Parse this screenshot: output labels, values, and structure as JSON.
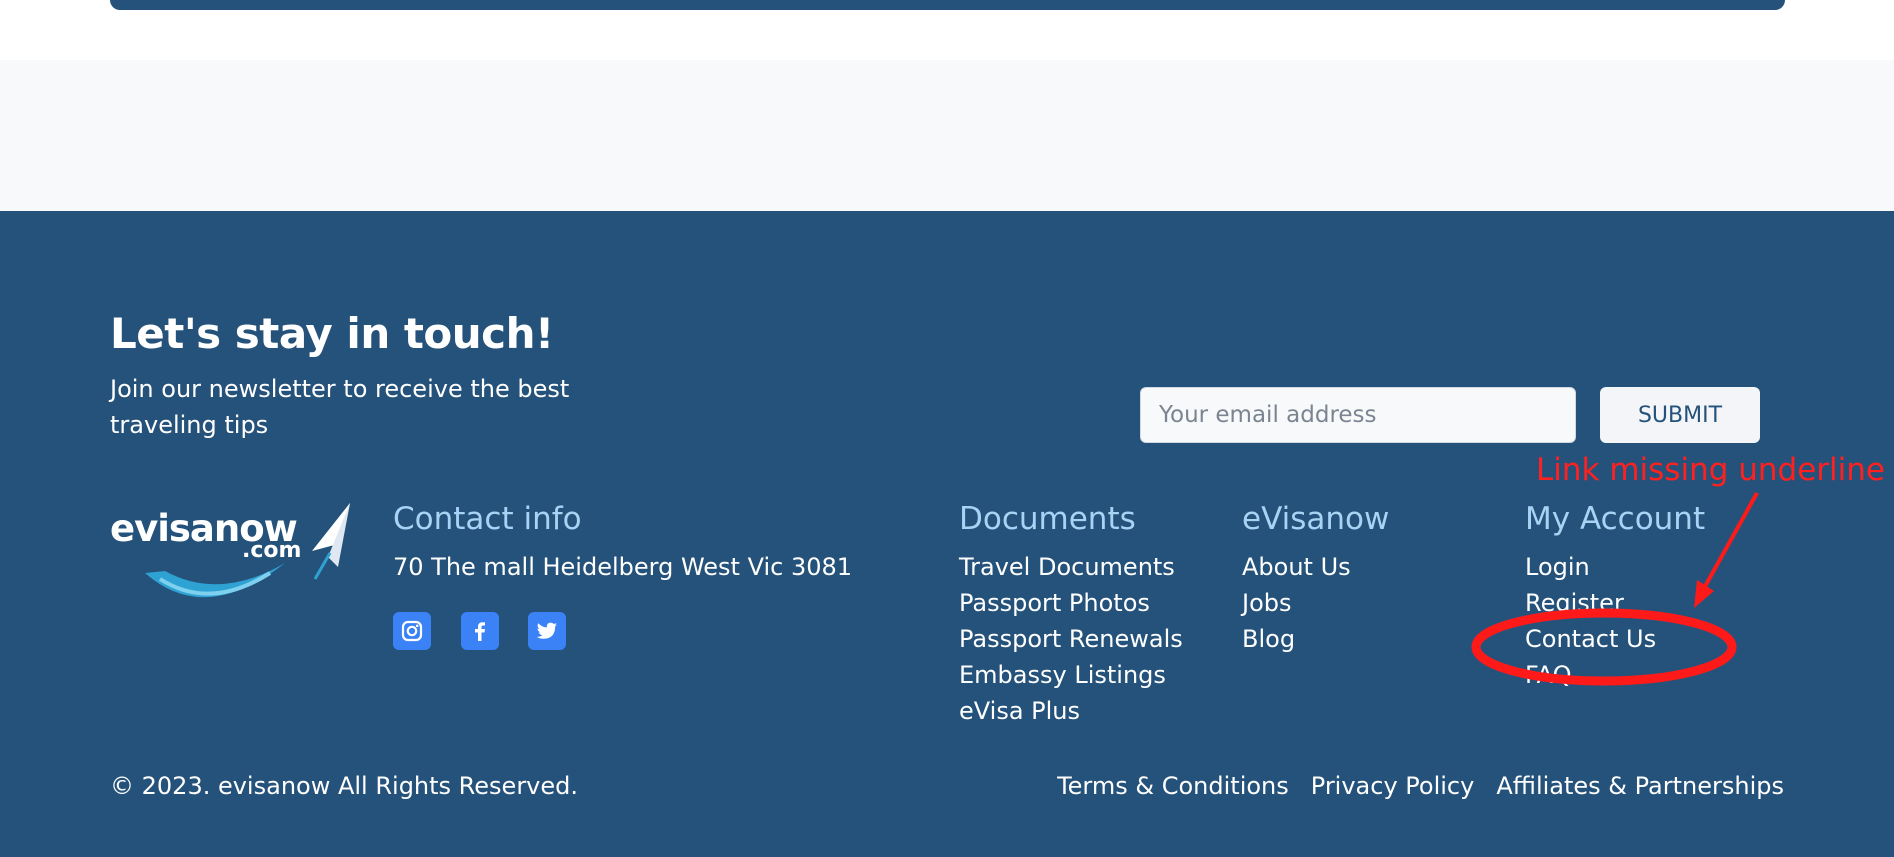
{
  "newsletter": {
    "title": "Let's stay in touch!",
    "subtitle": "Join our newsletter to receive the best traveling tips",
    "email_placeholder": "Your email address",
    "submit_label": "SUBMIT"
  },
  "logo": {
    "name": "evisanow",
    "suffix": ".com"
  },
  "contact": {
    "title": "Contact info",
    "address": "70 The mall Heidelberg West Vic 3081",
    "social_icons": [
      "instagram-icon",
      "facebook-icon",
      "twitter-icon"
    ]
  },
  "columns": [
    {
      "title": "Documents",
      "links": [
        "Travel Documents",
        "Passport Photos",
        "Passport Renewals",
        "Embassy Listings",
        "eVisa Plus"
      ]
    },
    {
      "title": "eVisanow",
      "links": [
        "About Us",
        "Jobs",
        "Blog"
      ]
    },
    {
      "title": "My Account",
      "links": [
        "Login",
        "Register",
        "Contact Us",
        "FAQ"
      ]
    }
  ],
  "bottom": {
    "copyright": "© 2023. evisanow All Rights Reserved.",
    "links": [
      "Terms & Conditions",
      "Privacy Policy",
      "Affiliates & Partnerships"
    ]
  },
  "annotation": {
    "text": "Link missing underline",
    "color": "#ff2020"
  },
  "colors": {
    "footer_bg": "#25527a",
    "heading_accent": "#a9d3f5",
    "social_bg": "#3b82f6",
    "light_bg": "#f8f9fb"
  }
}
